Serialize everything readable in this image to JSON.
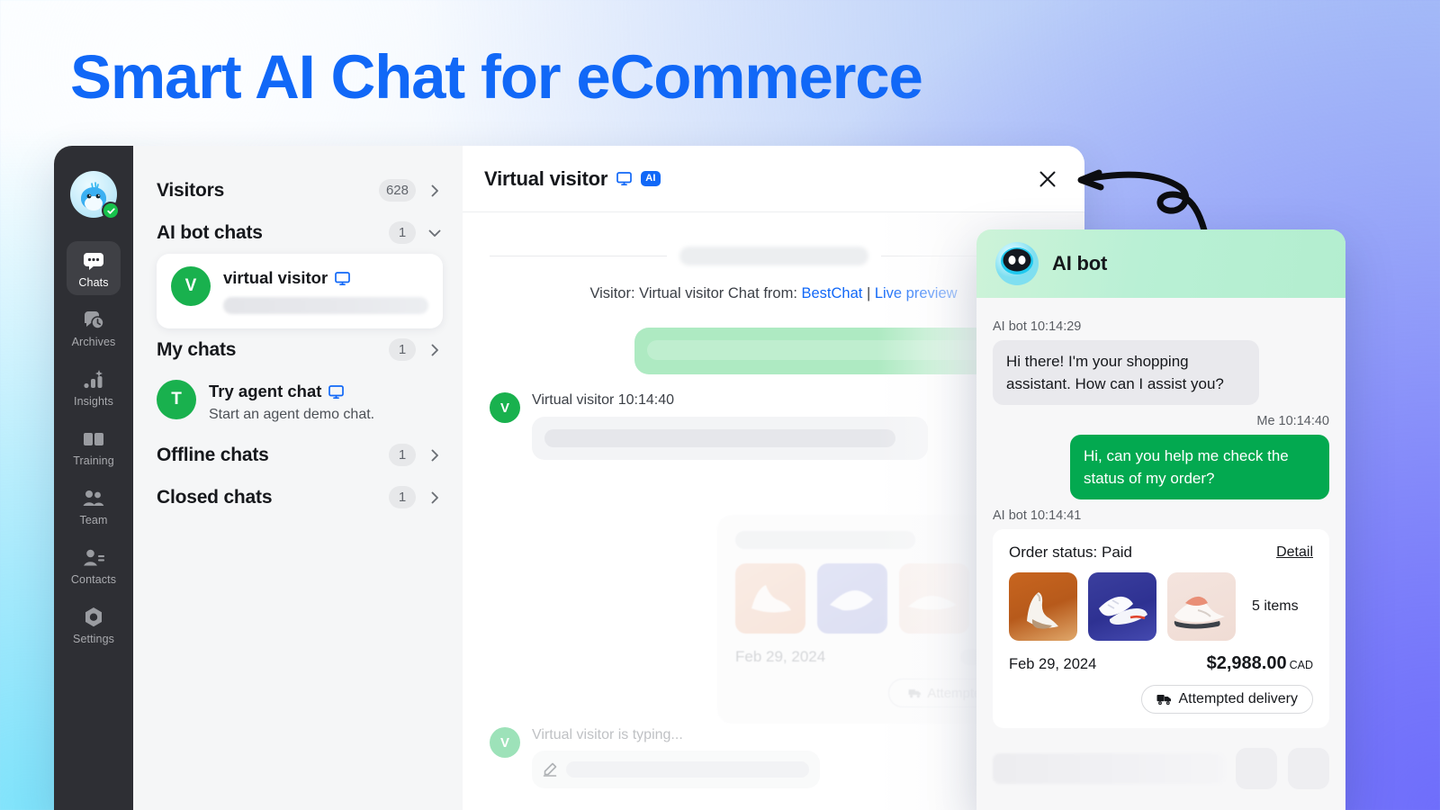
{
  "hero": {
    "title": "Smart AI Chat for eCommerce"
  },
  "colors": {
    "brand_blue": "#1168f7",
    "green": "#03a950",
    "avatar_green": "#19b14e",
    "rail_dark": "#2e2f34",
    "bot_header_green": "#b9f0d5"
  },
  "rail": {
    "avatar_icon": "whale-mascot-avatar",
    "status_icon": "online-check-badge",
    "items": [
      {
        "label": "Chats",
        "icon": "chat-bubbles-icon",
        "active": true
      },
      {
        "label": "Archives",
        "icon": "archive-clock-icon",
        "active": false
      },
      {
        "label": "Insights",
        "icon": "bar-chart-sparkle-icon",
        "active": false
      },
      {
        "label": "Training",
        "icon": "open-book-icon",
        "active": false
      },
      {
        "label": "Team",
        "icon": "people-group-icon",
        "active": false
      },
      {
        "label": "Contacts",
        "icon": "contact-person-icon",
        "active": false
      },
      {
        "label": "Settings",
        "icon": "gear-hexagon-icon",
        "active": false
      }
    ]
  },
  "list_panel": {
    "sections": [
      {
        "title": "Visitors",
        "count": "628",
        "chevron": "chevron-right-icon"
      },
      {
        "title": "AI bot chats",
        "count": "1",
        "chevron": "chevron-down-icon"
      },
      {
        "title": "My chats",
        "count": "1",
        "chevron": "chevron-right-icon"
      },
      {
        "title": "Offline chats",
        "count": "1",
        "chevron": "chevron-right-icon"
      },
      {
        "title": "Closed chats",
        "count": "1",
        "chevron": "chevron-right-icon"
      }
    ],
    "ai_bot_chat": {
      "initial": "V",
      "name": "virtual visitor",
      "device_icon": "desktop-monitor-icon",
      "preview": ""
    },
    "my_chat": {
      "initial": "T",
      "name": "Try agent chat",
      "device_icon": "desktop-monitor-icon",
      "preview": "Start an agent demo chat."
    }
  },
  "conversation": {
    "header": {
      "title": "Virtual visitor",
      "device_icon": "desktop-monitor-icon",
      "ai_badge": "AI",
      "close_icon": "close-icon"
    },
    "system_line": {
      "prefix": "Visitor: Virtual visitor Chat from: ",
      "link_1": "BestChat",
      "separator": " | ",
      "link_2": "Live preview"
    },
    "incoming": {
      "avatar_initial": "V",
      "meta": "Virtual visitor 10:14:40"
    },
    "ghost_order_card": {
      "date": "Feb 29, 2024",
      "pill_label": "Attempted delivery",
      "pill_icon": "delivery-truck-icon"
    },
    "typing": {
      "avatar_initial": "V",
      "text": "Virtual visitor is typing...",
      "pen_icon": "pencil-icon"
    }
  },
  "doodle": {
    "name": "hand-drawn-looped-arrow"
  },
  "bot_widget": {
    "header": {
      "title": "AI bot",
      "avatar_icon": "ai-robot-avatar-icon"
    },
    "messages": [
      {
        "side": "bot",
        "meta": "AI bot 10:14:29",
        "text": "Hi there! I'm your shopping assistant. How can I assist you?"
      },
      {
        "side": "me",
        "meta": "Me 10:14:40",
        "text": "Hi, can you help me check the status of my order?"
      }
    ],
    "order_message_meta": "AI bot 10:14:41",
    "order_card": {
      "status_label": "Order status: Paid",
      "detail_label": "Detail",
      "items_label": "5 items",
      "date": "Feb 29, 2024",
      "price": "$2,988.00",
      "currency": "CAD",
      "pill_label": "Attempted delivery",
      "pill_icon": "delivery-truck-icon",
      "thumbs": [
        {
          "name": "sneaker-thumb-orange"
        },
        {
          "name": "sneaker-thumb-navy"
        },
        {
          "name": "sneaker-thumb-beige"
        }
      ]
    },
    "footer": {
      "input_placeholder": "",
      "action_icon_1": "widget-action-button",
      "action_icon_2": "widget-send-button"
    }
  }
}
